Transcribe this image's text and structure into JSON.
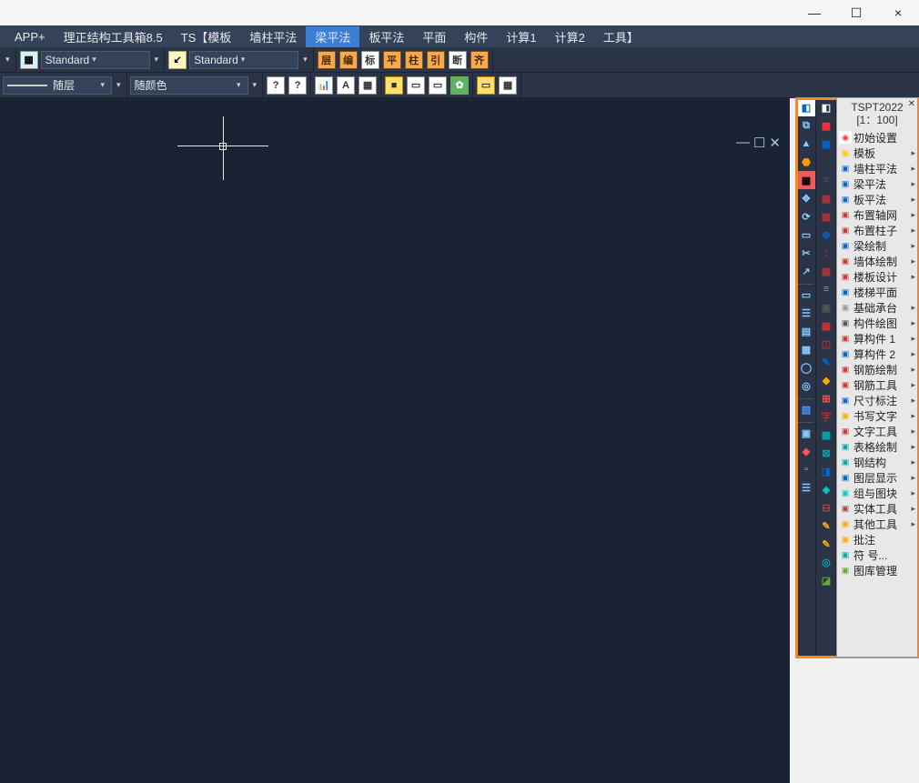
{
  "titlebar": {
    "min": "—",
    "max": "☐",
    "close": "×"
  },
  "menu": {
    "items": [
      "APP+",
      "理正结构工具箱8.5",
      "TS【模板",
      "墙柱平法",
      "梁平法",
      "板平法",
      "平面",
      "构件",
      "计算1",
      "计算2",
      "工具】"
    ],
    "active_index": 4
  },
  "toolbar1": {
    "style_combo1": "Standard",
    "style_combo2": "Standard",
    "letter_icons": [
      "层",
      "编",
      "标",
      "平",
      "柱",
      "引",
      "断",
      "齐"
    ]
  },
  "toolbar2": {
    "layer": "随层",
    "color": "随颜色"
  },
  "canvas": {
    "icons": [
      "—",
      "☐",
      "✕"
    ]
  },
  "side_panel": {
    "title_line1": "TSPT2022",
    "title_line2": "[1：100]",
    "items": [
      {
        "label": "初始设置",
        "arrow": false
      },
      {
        "label": "模板",
        "arrow": true
      },
      {
        "label": "墙柱平法",
        "arrow": true
      },
      {
        "label": "梁平法",
        "arrow": true
      },
      {
        "label": "板平法",
        "arrow": true
      },
      {
        "label": "布置轴网",
        "arrow": true
      },
      {
        "label": "布置柱子",
        "arrow": true
      },
      {
        "label": "梁绘制",
        "arrow": true
      },
      {
        "label": "墙体绘制",
        "arrow": true
      },
      {
        "label": "楼板设计",
        "arrow": true
      },
      {
        "label": "楼梯平面",
        "arrow": false
      },
      {
        "label": "基础承台",
        "arrow": true
      },
      {
        "label": "构件绘图",
        "arrow": true
      },
      {
        "label": "算构件 1",
        "arrow": true
      },
      {
        "label": "算构件 2",
        "arrow": true
      },
      {
        "label": "钢筋绘制",
        "arrow": true
      },
      {
        "label": "钢筋工具",
        "arrow": true
      },
      {
        "label": "尺寸标注",
        "arrow": true
      },
      {
        "label": "书写文字",
        "arrow": true
      },
      {
        "label": "文字工具",
        "arrow": true
      },
      {
        "label": "表格绘制",
        "arrow": true
      },
      {
        "label": "钢结构",
        "arrow": true
      },
      {
        "label": "图层显示",
        "arrow": true
      },
      {
        "label": "组与图块",
        "arrow": true
      },
      {
        "label": "实体工具",
        "arrow": true
      },
      {
        "label": "其他工具",
        "arrow": true
      },
      {
        "label": "批注",
        "arrow": false
      },
      {
        "label": "符 号...",
        "arrow": false
      },
      {
        "label": "图库管理",
        "arrow": false
      }
    ]
  }
}
